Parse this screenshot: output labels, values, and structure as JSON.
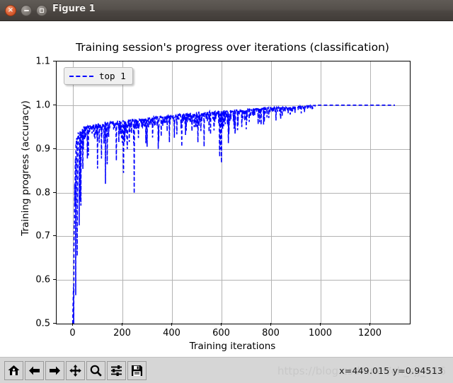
{
  "window": {
    "title": "Figure 1",
    "controls": [
      {
        "name": "close",
        "glyph": "×"
      },
      {
        "name": "minimize",
        "glyph": "–"
      },
      {
        "name": "maximize",
        "glyph": "□"
      }
    ]
  },
  "toolbar": {
    "buttons": [
      {
        "name": "home-icon",
        "tooltip": "Reset original view"
      },
      {
        "name": "back-arrow-icon",
        "tooltip": "Back to previous view"
      },
      {
        "name": "forward-arrow-icon",
        "tooltip": "Forward to next view"
      },
      {
        "name": "pan-move-icon",
        "tooltip": "Pan axes with left mouse, zoom with right"
      },
      {
        "name": "zoom-magnifier-icon",
        "tooltip": "Zoom to rectangle"
      },
      {
        "name": "configure-sliders-icon",
        "tooltip": "Configure subplots"
      },
      {
        "name": "save-floppy-icon",
        "tooltip": "Save the figure"
      }
    ],
    "status": "x=449.015    y=0.94513",
    "watermark": "https://blog.csdn.net/ch_sjj_116"
  },
  "chart_data": {
    "type": "line",
    "title": "Training session's progress over iterations (classification)",
    "xlabel": "Training iterations",
    "ylabel": "Training progress (accuracy)",
    "xlim": [
      -65,
      1360
    ],
    "ylim": [
      0.5,
      1.1
    ],
    "xticks": [
      0,
      200,
      400,
      600,
      800,
      1000,
      1200
    ],
    "xticklabels": [
      "0",
      "200",
      "400",
      "600",
      "800",
      "1000",
      "1200"
    ],
    "yticks": [
      0.5,
      0.6,
      0.7,
      0.8,
      0.9,
      1.0,
      1.1
    ],
    "yticklabels": [
      "0.5",
      "0.6",
      "0.7",
      "0.8",
      "0.9",
      "1.0",
      "1.1"
    ],
    "grid": true,
    "legend": {
      "position": "upper left",
      "entries": [
        {
          "label": "top 1",
          "color": "#0000ff",
          "linestyle": "dashed"
        }
      ]
    },
    "series": [
      {
        "name": "top 1",
        "color": "#0000ff",
        "linestyle": "dashed",
        "linewidth": 1.6,
        "description": "Accuracy rises steeply from 0.50 at iteration 0 to ~0.93 by iteration 20, then climbs noisily toward 1.00, with frequent downward spikes that shrink with iterations; converges to a flat 1.00 after ~iteration 980.",
        "envelope": {
          "x": [
            0,
            5,
            10,
            15,
            20,
            30,
            50,
            80,
            120,
            160,
            200,
            250,
            300,
            350,
            400,
            450,
            500,
            550,
            600,
            650,
            700,
            750,
            800,
            850,
            900,
            950,
            1000,
            1100,
            1200,
            1300
          ],
          "upper": [
            0.5,
            0.72,
            0.9,
            0.935,
            0.945,
            0.95,
            0.953,
            0.957,
            0.96,
            0.963,
            0.966,
            0.969,
            0.972,
            0.975,
            0.978,
            0.981,
            0.984,
            0.986,
            0.988,
            0.99,
            0.992,
            0.994,
            0.995,
            0.996,
            0.997,
            0.999,
            1.0,
            1.0,
            1.0,
            1.0
          ],
          "lower": [
            0.5,
            0.5,
            0.57,
            0.72,
            0.79,
            0.725,
            0.86,
            0.88,
            0.82,
            0.895,
            0.8,
            0.9,
            0.91,
            0.915,
            0.918,
            0.92,
            0.92,
            0.925,
            0.87,
            0.935,
            0.94,
            0.95,
            0.96,
            0.968,
            0.975,
            0.985,
            1.0,
            1.0,
            1.0,
            1.0
          ]
        },
        "spikes": [
          {
            "x": 4,
            "y": 0.5
          },
          {
            "x": 12,
            "y": 0.565
          },
          {
            "x": 18,
            "y": 0.655
          },
          {
            "x": 26,
            "y": 0.725
          },
          {
            "x": 33,
            "y": 0.77
          },
          {
            "x": 40,
            "y": 0.87
          },
          {
            "x": 63,
            "y": 0.885
          },
          {
            "x": 100,
            "y": 0.855
          },
          {
            "x": 132,
            "y": 0.82
          },
          {
            "x": 176,
            "y": 0.873
          },
          {
            "x": 205,
            "y": 0.845
          },
          {
            "x": 248,
            "y": 0.798
          },
          {
            "x": 300,
            "y": 0.905
          },
          {
            "x": 345,
            "y": 0.9
          },
          {
            "x": 390,
            "y": 0.915
          },
          {
            "x": 440,
            "y": 0.905
          },
          {
            "x": 505,
            "y": 0.915
          },
          {
            "x": 530,
            "y": 0.905
          },
          {
            "x": 600,
            "y": 0.868
          },
          {
            "x": 655,
            "y": 0.935
          },
          {
            "x": 700,
            "y": 0.945
          },
          {
            "x": 760,
            "y": 0.955
          },
          {
            "x": 820,
            "y": 0.965
          }
        ],
        "endpoints": {
          "start": [
            0,
            0.5
          ],
          "converge": [
            980,
            1.0
          ],
          "end": [
            1300,
            1.0
          ]
        }
      }
    ]
  }
}
